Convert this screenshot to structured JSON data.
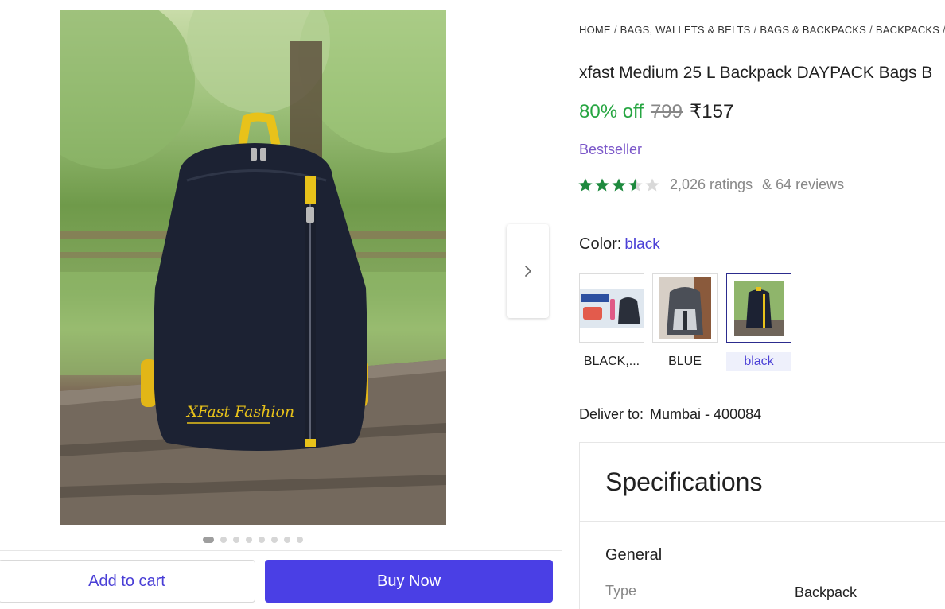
{
  "breadcrumb": [
    "HOME",
    "BAGS, WALLETS & BELTS",
    "BAGS & BACKPACKS",
    "BACKPACKS"
  ],
  "product": {
    "title": "xfast Medium 25 L Backpack DAYPACK Bags B",
    "discount": "80% off",
    "mrp": "799",
    "price": "₹157",
    "badge": "Bestseller",
    "rating_value": 3.5,
    "ratings_text": "2,026 ratings",
    "reviews_text": "& 64 reviews",
    "brand_on_image": "XFast Fashion"
  },
  "color": {
    "label": "Color:",
    "selected": "black",
    "options": [
      {
        "label": "BLACK,...",
        "icon": "combo-offer-thumbnail",
        "selected": false
      },
      {
        "label": "BLUE",
        "icon": "blue-backpack-thumbnail",
        "selected": false
      },
      {
        "label": "black",
        "icon": "black-backpack-thumbnail",
        "selected": true
      }
    ]
  },
  "delivery": {
    "label": "Deliver to:",
    "value": "Mumbai - 400084"
  },
  "specifications": {
    "title": "Specifications",
    "group": "General",
    "rows": [
      {
        "key": "Type",
        "value": "Backpack"
      }
    ]
  },
  "gallery": {
    "image_count": 8,
    "active_index": 0
  },
  "actions": {
    "add_to_cart": "Add to cart",
    "buy_now": "Buy Now"
  },
  "colors": {
    "accent": "#4a3fe5",
    "discount_green": "#26a541",
    "star_green": "#1e8a3e",
    "badge_purple": "#7b57c9"
  }
}
